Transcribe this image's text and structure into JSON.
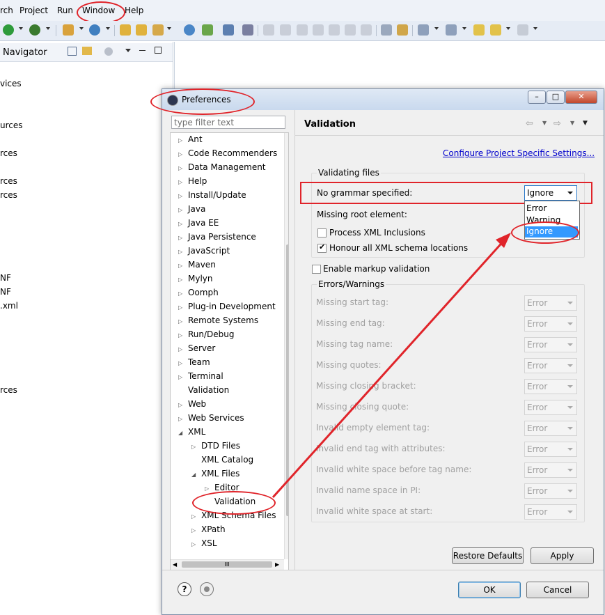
{
  "menubar": {
    "items": [
      "rch",
      "Project",
      "Run",
      "Window",
      "Help"
    ]
  },
  "navigator": {
    "title": "Navigator",
    "items": [
      "vices",
      "urces",
      "rces",
      "rces",
      "rces",
      "NF",
      "NF",
      ".xml",
      "rces"
    ]
  },
  "dialog": {
    "title": "Preferences",
    "filter_placeholder": "type filter text",
    "tree": [
      {
        "label": "Ant",
        "arrow": true
      },
      {
        "label": "Code Recommenders",
        "arrow": true
      },
      {
        "label": "Data Management",
        "arrow": true
      },
      {
        "label": "Help",
        "arrow": true
      },
      {
        "label": "Install/Update",
        "arrow": true
      },
      {
        "label": "Java",
        "arrow": true
      },
      {
        "label": "Java EE",
        "arrow": true
      },
      {
        "label": "Java Persistence",
        "arrow": true
      },
      {
        "label": "JavaScript",
        "arrow": true
      },
      {
        "label": "Maven",
        "arrow": true
      },
      {
        "label": "Mylyn",
        "arrow": true
      },
      {
        "label": "Oomph",
        "arrow": true
      },
      {
        "label": "Plug-in Development",
        "arrow": true
      },
      {
        "label": "Remote Systems",
        "arrow": true
      },
      {
        "label": "Run/Debug",
        "arrow": true
      },
      {
        "label": "Server",
        "arrow": true
      },
      {
        "label": "Team",
        "arrow": true
      },
      {
        "label": "Terminal",
        "arrow": true
      },
      {
        "label": "Validation",
        "arrow": false
      },
      {
        "label": "Web",
        "arrow": true
      },
      {
        "label": "Web Services",
        "arrow": true
      },
      {
        "label": "XML",
        "arrow": "open"
      },
      {
        "label": "DTD Files",
        "arrow": true
      },
      {
        "label": "XML Catalog",
        "arrow": false
      },
      {
        "label": "XML Files",
        "arrow": "open"
      },
      {
        "label": "Editor",
        "arrow": true
      },
      {
        "label": "Validation",
        "arrow": false
      },
      {
        "label": "XML Schema Files",
        "arrow": true
      },
      {
        "label": "XPath",
        "arrow": true
      },
      {
        "label": "XSL",
        "arrow": true
      }
    ],
    "hscroll_thumb": "III",
    "page_title": "Validation",
    "configure_link": "Configure Project Specific Settings...",
    "validating_files_label": "Validating files",
    "no_grammar_label": "No grammar specified:",
    "no_grammar_value": "Ignore",
    "dropdown_options": [
      "Error",
      "Warning",
      "Ignore"
    ],
    "dropdown_selected": "Ignore",
    "missing_root_label": "Missing root element:",
    "process_xml_label": "Process XML Inclusions",
    "honour_schema_label": "Honour all XML schema locations",
    "enable_markup_label": "Enable markup validation",
    "errors_warnings_label": "Errors/Warnings",
    "error_rows": [
      {
        "label": "Missing start tag:",
        "value": "Error"
      },
      {
        "label": "Missing end tag:",
        "value": "Error"
      },
      {
        "label": "Missing tag name:",
        "value": "Error"
      },
      {
        "label": "Missing quotes:",
        "value": "Error"
      },
      {
        "label": "Missing closing bracket:",
        "value": "Error"
      },
      {
        "label": "Missing closing quote:",
        "value": "Error"
      },
      {
        "label": "Invalid empty element tag:",
        "value": "Error"
      },
      {
        "label": "Invalid end tag with attributes:",
        "value": "Error"
      },
      {
        "label": "Invalid white space before tag name:",
        "value": "Error"
      },
      {
        "label": "Invalid name space in PI:",
        "value": "Error"
      },
      {
        "label": "Invalid white space at start:",
        "value": "Error"
      }
    ],
    "restore_defaults": "Restore Defaults",
    "apply": "Apply",
    "ok": "OK",
    "cancel": "Cancel",
    "help_icon": "?"
  },
  "colors": {
    "annotation": "#e0242a",
    "selection": "#3399ff",
    "link": "#0000cc"
  }
}
